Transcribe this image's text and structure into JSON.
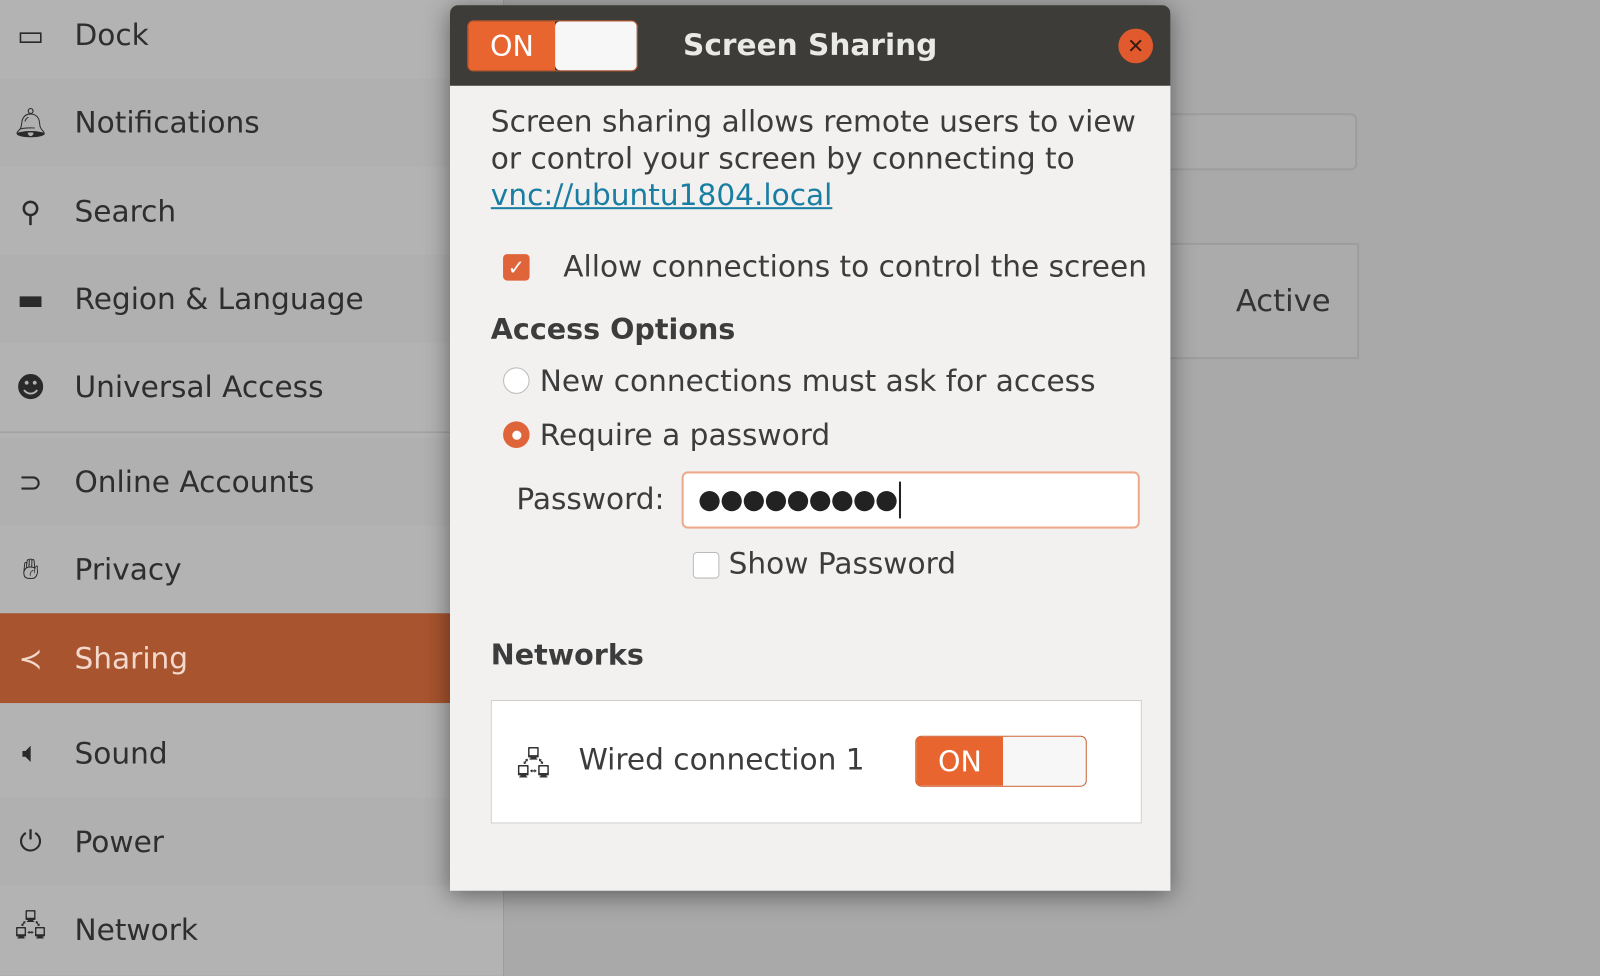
{
  "sidebar": {
    "items": [
      {
        "label": "Dock",
        "icon": "dock-icon"
      },
      {
        "label": "Notifications",
        "icon": "bell-icon"
      },
      {
        "label": "Search",
        "icon": "search-icon"
      },
      {
        "label": "Region & Language",
        "icon": "region-icon"
      },
      {
        "label": "Universal Access",
        "icon": "accessibility-icon"
      },
      {
        "label": "Online Accounts",
        "icon": "online-accounts-icon"
      },
      {
        "label": "Privacy",
        "icon": "hand-icon"
      },
      {
        "label": "Sharing",
        "icon": "share-icon",
        "selected": true
      },
      {
        "label": "Sound",
        "icon": "speaker-icon"
      },
      {
        "label": "Power",
        "icon": "power-plug-icon"
      },
      {
        "label": "Network",
        "icon": "network-icon"
      }
    ]
  },
  "background": {
    "status": "Active"
  },
  "dialog": {
    "title": "Screen Sharing",
    "toggle_label": "ON",
    "toggle_on": true,
    "description": "Screen sharing allows remote users to view or control your screen by connecting to ",
    "link": "vnc://ubuntu1804.local",
    "allow_control_label": "Allow connections to control the screen",
    "allow_control_checked": true,
    "access_options_heading": "Access Options",
    "option_ask": "New connections must ask for access",
    "option_password": "Require a password",
    "selected_option": "password",
    "password_label": "Password:",
    "password_value": "●●●●●●●●●",
    "show_password_label": "Show Password",
    "show_password_checked": false,
    "networks_heading": "Networks",
    "networks": [
      {
        "name": "Wired connection 1",
        "toggle_label": "ON",
        "on": true
      }
    ]
  },
  "colors": {
    "accent": "#e8652f",
    "selected_row": "#a8542f",
    "link": "#1a7ea3",
    "header": "#3d3c38"
  }
}
